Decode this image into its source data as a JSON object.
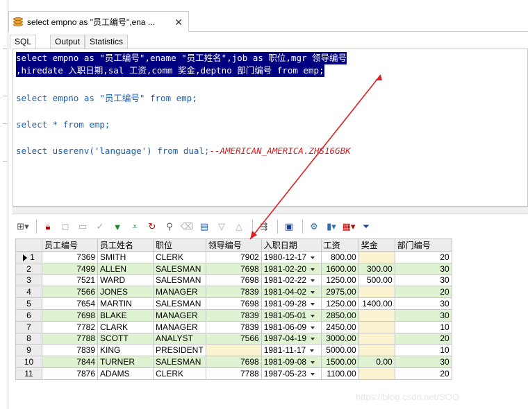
{
  "tab": {
    "title": "select empno as \"员工编号\",ena ...",
    "close": "✕"
  },
  "subtabs": [
    "SQL",
    "Output",
    "Statistics"
  ],
  "editor": {
    "line1": "select empno as \"员工编号\",ename \"员工姓名\",job as 职位,mgr 领导编号",
    "line2": ",hiredate 入职日期,sal 工资,comm 奖金,deptno 部门编号 from emp;",
    "line3": "select empno as \"员工编号\" from emp;",
    "line4": "select * from emp;",
    "line5_code": "select userenv('language') from dual;",
    "line5_comment": "--AMERICAN_AMERICA.ZHS16GBK"
  },
  "toolbar_icons": [
    "grid-options-icon",
    "lock-icon",
    "clear-icon",
    "record-icon",
    "check-icon",
    "filter-down-icon",
    "filter-clear-icon",
    "refresh-icon",
    "find-icon",
    "eraser-icon",
    "export-icon",
    "sort-down-icon",
    "sort-up-icon",
    "link-icon",
    "save-icon",
    "query-icon",
    "chart-icon",
    "table-view-icon",
    "filter-funnel-icon"
  ],
  "grid": {
    "columns": [
      "员工编号",
      "员工姓名",
      "职位",
      "领导编号",
      "入职日期",
      "工资",
      "奖金",
      "部门编号"
    ],
    "rows": [
      [
        "1",
        "7369",
        "SMITH",
        "CLERK",
        "7902",
        "1980-12-17",
        "800.00",
        "",
        "20"
      ],
      [
        "2",
        "7499",
        "ALLEN",
        "SALESMAN",
        "7698",
        "1981-02-20",
        "1600.00",
        "300.00",
        "30"
      ],
      [
        "3",
        "7521",
        "WARD",
        "SALESMAN",
        "7698",
        "1981-02-22",
        "1250.00",
        "500.00",
        "30"
      ],
      [
        "4",
        "7566",
        "JONES",
        "MANAGER",
        "7839",
        "1981-04-02",
        "2975.00",
        "",
        "20"
      ],
      [
        "5",
        "7654",
        "MARTIN",
        "SALESMAN",
        "7698",
        "1981-09-28",
        "1250.00",
        "1400.00",
        "30"
      ],
      [
        "6",
        "7698",
        "BLAKE",
        "MANAGER",
        "7839",
        "1981-05-01",
        "2850.00",
        "",
        "30"
      ],
      [
        "7",
        "7782",
        "CLARK",
        "MANAGER",
        "7839",
        "1981-06-09",
        "2450.00",
        "",
        "10"
      ],
      [
        "8",
        "7788",
        "SCOTT",
        "ANALYST",
        "7566",
        "1987-04-19",
        "3000.00",
        "",
        "20"
      ],
      [
        "9",
        "7839",
        "KING",
        "PRESIDENT",
        "",
        "1981-11-17",
        "5000.00",
        "",
        "10"
      ],
      [
        "10",
        "7844",
        "TURNER",
        "SALESMAN",
        "7698",
        "1981-09-08",
        "1500.00",
        "0.00",
        "30"
      ],
      [
        "11",
        "7876",
        "ADAMS",
        "CLERK",
        "7788",
        "1987-05-23",
        "1100.00",
        "",
        "20"
      ]
    ]
  },
  "watermark": "https://blog.csdn.net/SOO",
  "colors": {
    "selection": "#000080",
    "keyword": "#1a5fb4",
    "comment": "#d41e1e",
    "row_alt": "#dff3d2",
    "null_cell": "#fbf3cf",
    "arrow": "#e02020"
  }
}
